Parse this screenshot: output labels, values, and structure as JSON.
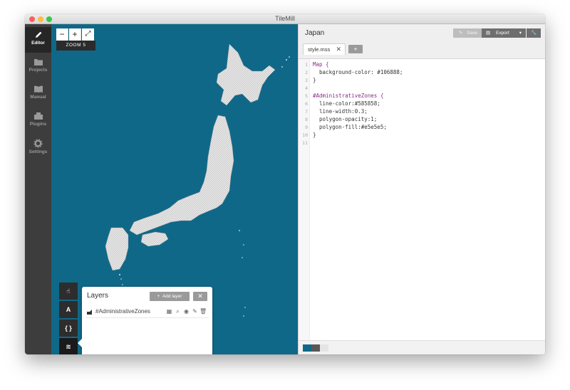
{
  "window": {
    "title": "TileMill"
  },
  "sidebar": {
    "items": [
      {
        "label": "Editor",
        "icon": "pencil-icon",
        "active": true
      },
      {
        "label": "Projects",
        "icon": "folder-icon",
        "active": false
      },
      {
        "label": "Manual",
        "icon": "book-icon",
        "active": false
      },
      {
        "label": "Plugins",
        "icon": "plugin-icon",
        "active": false
      },
      {
        "label": "Settings",
        "icon": "gear-icon",
        "active": false
      }
    ]
  },
  "map": {
    "background": "#106888",
    "zoom": {
      "minus": "−",
      "plus": "+",
      "fullscreen": "⤢",
      "label": "ZOOM 5"
    },
    "tools": [
      {
        "icon": "hand-icon",
        "glyph": "☝"
      },
      {
        "icon": "font-icon",
        "glyph": "A"
      },
      {
        "icon": "brackets-icon",
        "glyph": "{ }"
      },
      {
        "icon": "layers-icon",
        "glyph": "≋"
      }
    ]
  },
  "layers_panel": {
    "title": "Layers",
    "add_label": "Add layer",
    "add_icon": "+",
    "close_icon": "✕",
    "layer": {
      "name": "#AdministrativeZones"
    }
  },
  "editor": {
    "project_title": "Japan",
    "save_label": "Save",
    "export_label": "Export",
    "tab_label": "style.mss",
    "tab_close": "✕",
    "tab_add": "+",
    "code_lines": [
      "Map {",
      "  background-color: #106888;",
      "}",
      "",
      "#AdministrativeZones {",
      "  line-color:#585858;",
      "  line-width:0.3;",
      "  polygon-opacity:1;",
      "  polygon-fill:#e5e5e5;",
      "}",
      ""
    ],
    "line_numbers": [
      "1",
      "2",
      "3",
      "4",
      "5",
      "6",
      "7",
      "8",
      "9",
      "10",
      "11"
    ],
    "palette": [
      "#106888",
      "#585858",
      "#e5e5e5"
    ]
  }
}
